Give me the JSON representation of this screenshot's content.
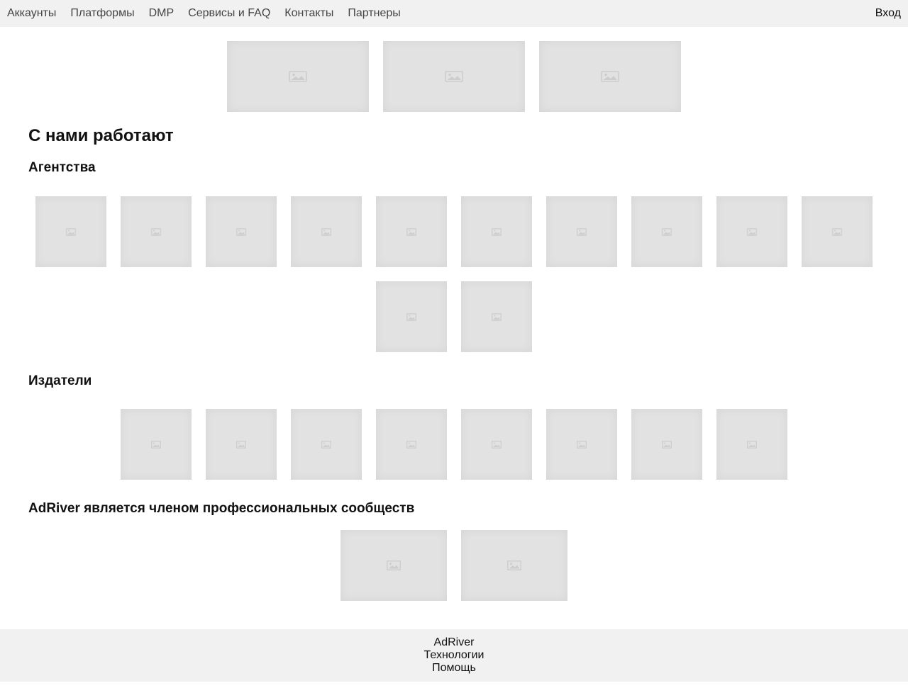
{
  "nav": {
    "items": [
      {
        "label": "Аккаунты"
      },
      {
        "label": "Платформы"
      },
      {
        "label": "DMP"
      },
      {
        "label": "Сервисы и FAQ"
      },
      {
        "label": "Контакты"
      },
      {
        "label": "Партнеры"
      }
    ],
    "login_label": "Вход"
  },
  "hero": {
    "banner_count": 3
  },
  "partners": {
    "title": "С нами работают",
    "agencies": {
      "title": "Агентства",
      "logo_count": 12
    },
    "publishers": {
      "title": "Издатели",
      "logo_count": 8
    },
    "communities": {
      "title": "AdRiver является членом профессиональных сообществ",
      "logo_count": 2
    }
  },
  "footer": {
    "links": [
      {
        "label": "AdRiver"
      },
      {
        "label": "Технологии"
      },
      {
        "label": "Помощь"
      }
    ]
  },
  "colors": {
    "topbar_bg": "#f1f1f1",
    "placeholder_bg": "#e2e2e2",
    "footer_bg": "#f1f1f1"
  },
  "icons": {
    "placeholder": "image-placeholder-icon"
  }
}
